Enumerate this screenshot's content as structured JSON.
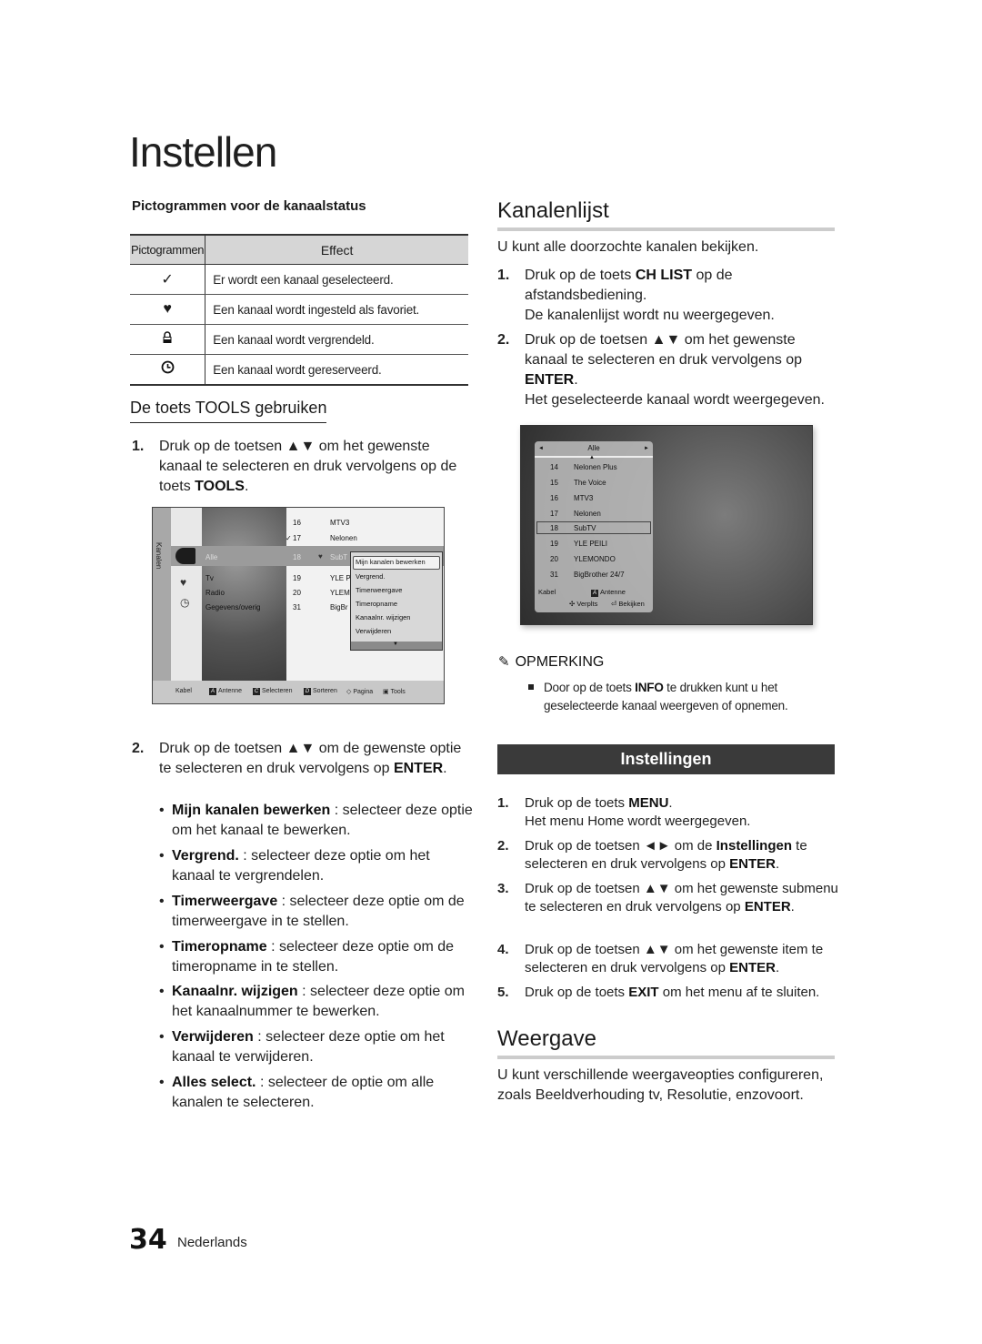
{
  "page": {
    "title": "Instellen",
    "page_number": "34",
    "language": "Nederlands"
  },
  "icons_section": {
    "heading": "Pictogrammen voor de kanaalstatus",
    "table": {
      "headers": [
        "Pictogrammen",
        "Effect"
      ],
      "rows": [
        {
          "icon": "checkmark-icon",
          "glyph": "✓",
          "effect": "Er wordt een kanaal geselecteerd."
        },
        {
          "icon": "heart-icon",
          "glyph": "♥",
          "effect": "Een kanaal wordt ingesteld als favoriet."
        },
        {
          "icon": "lock-icon",
          "glyph": "🔒",
          "effect": "Een kanaal wordt vergrendeld."
        },
        {
          "icon": "clock-icon",
          "glyph": "◷",
          "effect": "Een kanaal wordt gereserveerd."
        }
      ]
    }
  },
  "tools_section": {
    "heading": "De toets TOOLS gebruiken",
    "step1": {
      "num": "1.",
      "pre": "Druk op de toetsen ▲▼ om het gewenste kanaal te selecteren en druk vervolgens op de toets ",
      "key": "TOOLS",
      "post": "."
    },
    "step2": {
      "num": "2.",
      "pre": "Druk op de toetsen ▲▼ om de gewenste optie te selecteren en druk vervolgens op ",
      "key": "ENTER",
      "post": "."
    },
    "bullets": [
      {
        "term": "Mijn kanalen bewerken",
        "desc": " : selecteer deze optie om het kanaal te bewerken."
      },
      {
        "term": "Vergrend.",
        "desc": " : selecteer deze optie om het kanaal te vergrendelen."
      },
      {
        "term": "Timerweergave",
        "desc": " : selecteer deze optie om de timerweergave in te stellen."
      },
      {
        "term": "Timeropname",
        "desc": " : selecteer deze optie om de timeropname in te stellen."
      },
      {
        "term": "Kanaalnr. wijzigen",
        "desc": " : selecteer deze optie om het kanaalnummer te bewerken."
      },
      {
        "term": "Verwijderen",
        "desc": " : selecteer deze optie om het kanaal te verwijderen."
      },
      {
        "term": "Alles select.",
        "desc": " : selecteer de optie om alle kanalen te selecteren."
      }
    ]
  },
  "tv_screen_tools": {
    "side_tab": "Kanalen",
    "categories": [
      "Alle",
      "Tv",
      "Radio",
      "Gegevens/overig"
    ],
    "channels": [
      {
        "num": "16",
        "name": "MTV3",
        "mark": ""
      },
      {
        "num": "17",
        "name": "Nelonen",
        "mark": "✓"
      },
      {
        "num": "18",
        "name": "SubT",
        "mark": "♥"
      },
      {
        "num": "19",
        "name": "YLE P",
        "mark": ""
      },
      {
        "num": "20",
        "name": "YLEM",
        "mark": ""
      },
      {
        "num": "31",
        "name": "BigBr",
        "mark": ""
      }
    ],
    "popup_items": [
      "Mijn kanalen bewerken",
      "Vergrend.",
      "Timerweergave",
      "Timeropname",
      "Kanaalnr. wijzigen",
      "Verwijderen"
    ],
    "footer": {
      "source": "Kabel",
      "a_key": "A",
      "a_label": "Antenne",
      "c_key": "C",
      "c_label": "Selecteren",
      "d_key": "D",
      "d_label": "Sorteren",
      "page_label": "Pagina",
      "tools_label": "Tools"
    }
  },
  "kanalenlijst": {
    "heading": "Kanalenlijst",
    "intro": "U kunt alle doorzochte kanalen bekijken.",
    "step1": {
      "num": "1.",
      "pre": "Druk op de toets ",
      "key": "CH LIST",
      "post": " op de afstandsbediening.",
      "result": "De kanalenlijst wordt nu weergegeven."
    },
    "step2": {
      "num": "2.",
      "pre": "Druk op de toetsen ▲▼ om het gewenste kanaal te selecteren en druk vervolgens op ",
      "key": "ENTER",
      "post": ".",
      "result": "Het geselecteerde kanaal wordt weergegeven."
    }
  },
  "tv_screen_list": {
    "header": "Alle",
    "channels": [
      {
        "num": "14",
        "name": "Nelonen Plus"
      },
      {
        "num": "15",
        "name": "The Voice"
      },
      {
        "num": "16",
        "name": "MTV3"
      },
      {
        "num": "17",
        "name": "Nelonen"
      },
      {
        "num": "18",
        "name": "SubTV"
      },
      {
        "num": "19",
        "name": "YLE PEILI"
      },
      {
        "num": "20",
        "name": "YLEMONDO"
      },
      {
        "num": "31",
        "name": "BigBrother 24/7"
      }
    ],
    "selected_index": 4,
    "footer": {
      "source": "Kabel",
      "a_key": "A",
      "a_label": "Antenne",
      "move_label": "Verplts",
      "view_label": "Bekijken"
    }
  },
  "note": {
    "heading": "OPMERKING",
    "pre": "Door op de toets ",
    "key": "INFO",
    "post": " te drukken kunt u het geselecteerde kanaal weergeven of opnemen."
  },
  "instellingen": {
    "bar_title": "Instellingen",
    "steps": [
      {
        "num": "1.",
        "pre": "Druk op de toets ",
        "key": "MENU",
        "post": ".",
        "result": "Het menu Home wordt weergegeven."
      },
      {
        "num": "2.",
        "pre": "Druk op de toetsen ◄► om de ",
        "key": "Instellingen",
        "mid": " te selecteren en druk vervolgens op ",
        "key2": "ENTER",
        "post": "."
      },
      {
        "num": "3.",
        "pre": "Druk op de toetsen ▲▼ om het gewenste submenu te selecteren en druk vervolgens op ",
        "key": "ENTER",
        "post": "."
      },
      {
        "num": "4.",
        "pre": "Druk op de toetsen ▲▼ om het gewenste item te selecteren en druk vervolgens op ",
        "key": "ENTER",
        "post": "."
      },
      {
        "num": "5.",
        "pre": "Druk op de toets ",
        "key": "EXIT",
        "post": " om het menu af te sluiten."
      }
    ]
  },
  "weergave": {
    "heading": "Weergave",
    "text": "U kunt verschillende weergaveopties configureren, zoals Beeldverhouding tv, Resolutie, enzovoort."
  }
}
